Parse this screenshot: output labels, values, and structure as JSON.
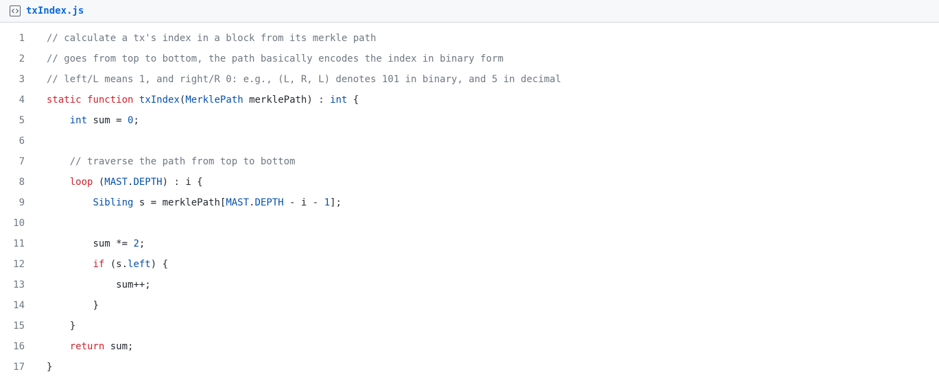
{
  "filename": "txIndex.js",
  "code": {
    "lines": [
      {
        "n": 1,
        "indent": 0,
        "tokens": [
          {
            "t": "// calculate a tx's index in a block from its merkle path",
            "c": "comment"
          }
        ]
      },
      {
        "n": 2,
        "indent": 0,
        "tokens": [
          {
            "t": "// goes from top to bottom, the path basically encodes the index in binary form",
            "c": "comment"
          }
        ]
      },
      {
        "n": 3,
        "indent": 0,
        "tokens": [
          {
            "t": "// left/L means 1, and right/R 0: e.g., (L, R, L) denotes 101 in binary, and 5 in decimal",
            "c": "comment"
          }
        ]
      },
      {
        "n": 4,
        "indent": 0,
        "tokens": [
          {
            "t": "static",
            "c": "keyword"
          },
          {
            "t": " "
          },
          {
            "t": "function",
            "c": "keyword"
          },
          {
            "t": " "
          },
          {
            "t": "txIndex",
            "c": "func"
          },
          {
            "t": "("
          },
          {
            "t": "MerklePath",
            "c": "type"
          },
          {
            "t": " merklePath) : "
          },
          {
            "t": "int",
            "c": "type"
          },
          {
            "t": " {"
          }
        ]
      },
      {
        "n": 5,
        "indent": 1,
        "tokens": [
          {
            "t": "int",
            "c": "type"
          },
          {
            "t": " sum = "
          },
          {
            "t": "0",
            "c": "number"
          },
          {
            "t": ";"
          }
        ]
      },
      {
        "n": 6,
        "indent": 0,
        "tokens": []
      },
      {
        "n": 7,
        "indent": 1,
        "tokens": [
          {
            "t": "// traverse the path from top to bottom",
            "c": "comment"
          }
        ]
      },
      {
        "n": 8,
        "indent": 1,
        "tokens": [
          {
            "t": "loop",
            "c": "keyword"
          },
          {
            "t": " ("
          },
          {
            "t": "MAST",
            "c": "type"
          },
          {
            "t": "."
          },
          {
            "t": "DEPTH",
            "c": "property"
          },
          {
            "t": ") : i {"
          }
        ]
      },
      {
        "n": 9,
        "indent": 2,
        "tokens": [
          {
            "t": "Sibling",
            "c": "type"
          },
          {
            "t": " s = merklePath["
          },
          {
            "t": "MAST",
            "c": "type"
          },
          {
            "t": "."
          },
          {
            "t": "DEPTH",
            "c": "property"
          },
          {
            "t": " - i - "
          },
          {
            "t": "1",
            "c": "number"
          },
          {
            "t": "];"
          }
        ]
      },
      {
        "n": 10,
        "indent": 0,
        "tokens": []
      },
      {
        "n": 11,
        "indent": 2,
        "tokens": [
          {
            "t": "sum *= "
          },
          {
            "t": "2",
            "c": "number"
          },
          {
            "t": ";"
          }
        ]
      },
      {
        "n": 12,
        "indent": 2,
        "tokens": [
          {
            "t": "if",
            "c": "keyword"
          },
          {
            "t": " (s."
          },
          {
            "t": "left",
            "c": "property"
          },
          {
            "t": ") {"
          }
        ]
      },
      {
        "n": 13,
        "indent": 3,
        "tokens": [
          {
            "t": "sum++;"
          }
        ]
      },
      {
        "n": 14,
        "indent": 2,
        "tokens": [
          {
            "t": "}"
          }
        ]
      },
      {
        "n": 15,
        "indent": 1,
        "tokens": [
          {
            "t": "}"
          }
        ]
      },
      {
        "n": 16,
        "indent": 1,
        "tokens": [
          {
            "t": "return",
            "c": "keyword"
          },
          {
            "t": " sum;"
          }
        ]
      },
      {
        "n": 17,
        "indent": 0,
        "tokens": [
          {
            "t": "}"
          }
        ]
      }
    ]
  }
}
